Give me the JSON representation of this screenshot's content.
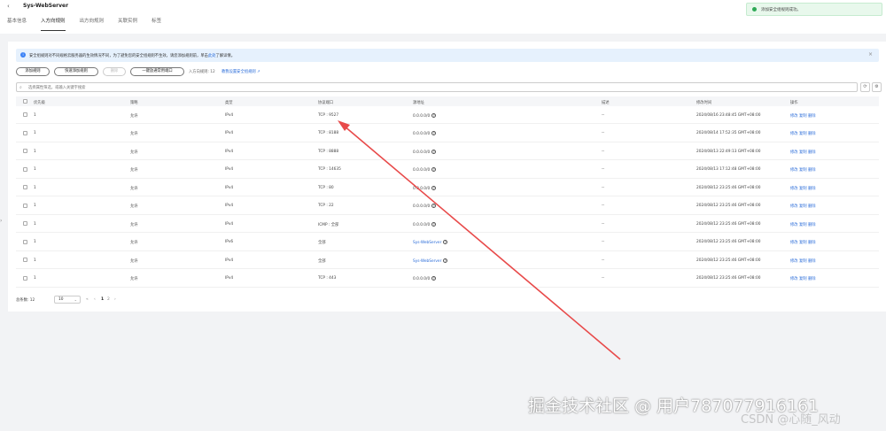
{
  "header": {
    "back_icon": "‹",
    "title": "Sys-WebServer",
    "tabs": [
      "基本信息",
      "入方向规则",
      "出方向规则",
      "关联实例",
      "标签"
    ],
    "active_tab": 1
  },
  "toast": {
    "text": "添加安全组规则成功。",
    "color": "#2ea956"
  },
  "notice": {
    "text": "安全组规则对不同规格云服务器的生效情况不同，为了避免您的安全组规则不生效，请您添加规则前，单击",
    "link": "此处",
    "suffix": "了解详情。",
    "close_icon": "×"
  },
  "toolbar": {
    "add_rule": "添加规则",
    "quick_add": "快速添加规则",
    "delete": "删除",
    "allow_common": "一键放通常用端口",
    "quota_label": "入方向规则: 12",
    "quota_link": "教我设置安全组规则"
  },
  "search": {
    "placeholder": "选择属性筛选，或输入关键字搜索",
    "refresh_icon": "⟳",
    "settings_icon": "⚙"
  },
  "table": {
    "columns": [
      "优先级",
      "策略",
      "类型",
      "协议端口",
      "源地址",
      "描述",
      "修改时间",
      "操作"
    ],
    "rows": [
      {
        "priority": "1",
        "policy": "允许",
        "type": "IPv4",
        "port": "TCP : 9527",
        "source": "0.0.0.0/0",
        "source_is_link": false,
        "desc": "--",
        "time": "2024/08/16 23:48:45 GMT+08:00"
      },
      {
        "priority": "1",
        "policy": "允许",
        "type": "IPv4",
        "port": "TCP : 8188",
        "source": "0.0.0.0/0",
        "source_is_link": false,
        "desc": "--",
        "time": "2024/08/14 17:52:35 GMT+08:00"
      },
      {
        "priority": "1",
        "policy": "允许",
        "type": "IPv4",
        "port": "TCP : 8888",
        "source": "0.0.0.0/0",
        "source_is_link": false,
        "desc": "--",
        "time": "2024/08/13 22:49:13 GMT+08:00"
      },
      {
        "priority": "1",
        "policy": "允许",
        "type": "IPv4",
        "port": "TCP : 14635",
        "source": "0.0.0.0/0",
        "source_is_link": false,
        "desc": "--",
        "time": "2024/08/13 17:12:48 GMT+08:00"
      },
      {
        "priority": "1",
        "policy": "允许",
        "type": "IPv4",
        "port": "TCP : 80",
        "source": "0.0.0.0/0",
        "source_is_link": false,
        "desc": "--",
        "time": "2024/08/12 23:25:46 GMT+08:00"
      },
      {
        "priority": "1",
        "policy": "允许",
        "type": "IPv4",
        "port": "TCP : 22",
        "source": "0.0.0.0/0",
        "source_is_link": false,
        "desc": "--",
        "time": "2024/08/12 23:25:46 GMT+08:00"
      },
      {
        "priority": "1",
        "policy": "允许",
        "type": "IPv4",
        "port": "ICMP : 全部",
        "source": "0.0.0.0/0",
        "source_is_link": false,
        "desc": "--",
        "time": "2024/08/12 23:25:46 GMT+08:00"
      },
      {
        "priority": "1",
        "policy": "允许",
        "type": "IPv6",
        "port": "全部",
        "source": "Sys-WebServer",
        "source_is_link": true,
        "desc": "--",
        "time": "2024/08/12 23:25:46 GMT+08:00"
      },
      {
        "priority": "1",
        "policy": "允许",
        "type": "IPv4",
        "port": "全部",
        "source": "Sys-WebServer",
        "source_is_link": true,
        "desc": "--",
        "time": "2024/08/12 23:25:46 GMT+08:00"
      },
      {
        "priority": "1",
        "policy": "允许",
        "type": "IPv4",
        "port": "TCP : 443",
        "source": "0.0.0.0/0",
        "source_is_link": false,
        "desc": "--",
        "time": "2024/08/12 23:25:46 GMT+08:00"
      }
    ],
    "actions": [
      "修改",
      "复制",
      "删除"
    ],
    "info_icon": "?"
  },
  "pagination": {
    "total": "总条数: 12",
    "page_size": "10",
    "prev_first": "«",
    "prev": "‹",
    "current": "1",
    "next_page": "2",
    "next": "›"
  },
  "side_handle": "›",
  "watermark": {
    "main": "掘金技术社区 @ 用户787077916161",
    "csdn": "CSDN @心随_风动"
  },
  "annotation_color": "#e84a4a"
}
